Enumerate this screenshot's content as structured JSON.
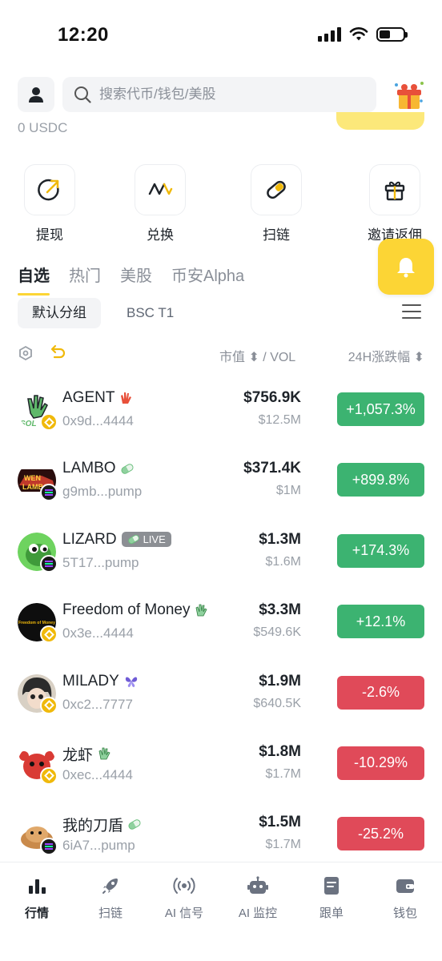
{
  "status": {
    "time": "12:20"
  },
  "search": {
    "placeholder": "搜索代币/钱包/美股"
  },
  "balance": "0 USDC",
  "actions": [
    {
      "label": "提现",
      "icon": "withdraw-icon"
    },
    {
      "label": "兑换",
      "icon": "swap-icon"
    },
    {
      "label": "扫链",
      "icon": "scan-chain-icon"
    },
    {
      "label": "邀请返佣",
      "icon": "gift-icon"
    }
  ],
  "tabs": [
    "自选",
    "热门",
    "美股",
    "币安Alpha"
  ],
  "groups": [
    "默认分组",
    "BSC T1"
  ],
  "columns": {
    "mcap_vol": "市值 ⬍ / VOL",
    "change": "24H涨跌幅 ⬍"
  },
  "rows": [
    {
      "name": "AGENT",
      "address": "0x9d...4444",
      "mcap": "$756.9K",
      "vol": "$12.5M",
      "change": "+1,057.3%",
      "direction": "up",
      "chain": "bsc",
      "badge": ""
    },
    {
      "name": "LAMBO",
      "address": "g9mb...pump",
      "mcap": "$371.4K",
      "vol": "$1M",
      "change": "+899.8%",
      "direction": "up",
      "chain": "sol",
      "badge": ""
    },
    {
      "name": "LIZARD",
      "address": "5T17...pump",
      "mcap": "$1.3M",
      "vol": "$1.6M",
      "change": "+174.3%",
      "direction": "up",
      "chain": "sol",
      "badge": "LIVE"
    },
    {
      "name": "Freedom of Money",
      "address": "0x3e...4444",
      "mcap": "$3.3M",
      "vol": "$549.6K",
      "change": "+12.1%",
      "direction": "up",
      "chain": "bsc",
      "badge": "",
      "logo_text": "Freedom of Money"
    },
    {
      "name": "MILADY",
      "address": "0xc2...7777",
      "mcap": "$1.9M",
      "vol": "$640.5K",
      "change": "-2.6%",
      "direction": "down",
      "chain": "bsc",
      "badge": ""
    },
    {
      "name": "龙虾",
      "address": "0xec...4444",
      "mcap": "$1.8M",
      "vol": "$1.7M",
      "change": "-10.29%",
      "direction": "down",
      "chain": "bsc",
      "badge": ""
    },
    {
      "name": "我的刀盾",
      "address": "6iA7...pump",
      "mcap": "$1.5M",
      "vol": "$1.7M",
      "change": "-25.2%",
      "direction": "down",
      "chain": "sol",
      "badge": ""
    }
  ],
  "nav": [
    "行情",
    "扫链",
    "AI 信号",
    "AI 监控",
    "跟单",
    "钱包"
  ],
  "colors": {
    "accent": "#fcd535",
    "up": "#3cb371",
    "down": "#e04a59"
  }
}
